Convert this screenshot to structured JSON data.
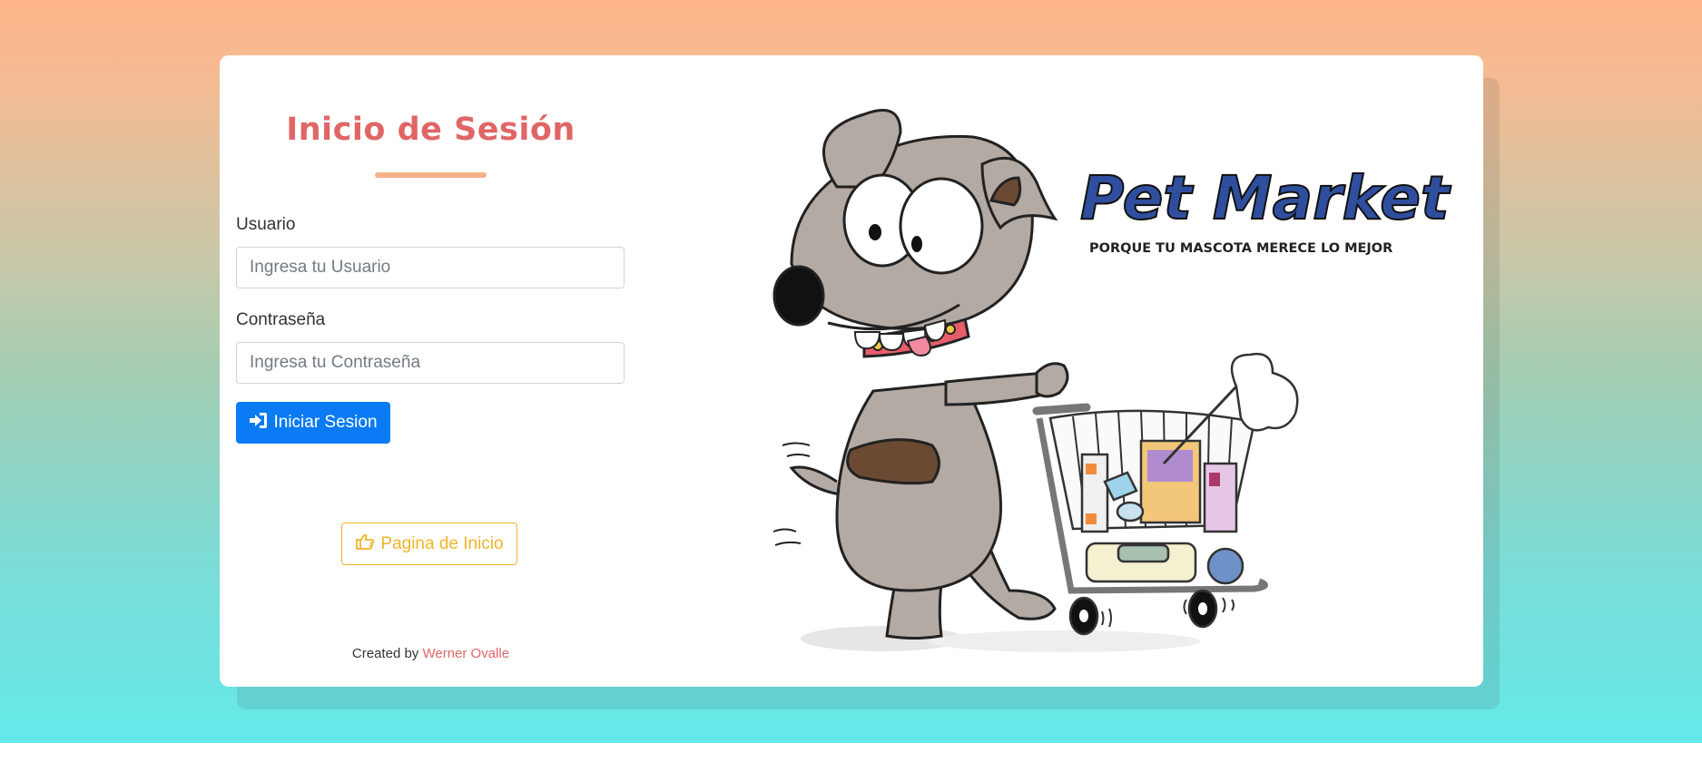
{
  "login": {
    "title": "Inicio de Sesión",
    "username_label": "Usuario",
    "username_placeholder": "Ingresa tu Usuario",
    "username_value": "",
    "password_label": "Contraseña",
    "password_placeholder": "Ingresa tu Contraseña",
    "password_value": "",
    "login_button": "Iniciar Sesion",
    "login_icon": "sign-in-icon",
    "home_button": "Pagina de Inicio",
    "home_icon": "hand-pointing-icon"
  },
  "footer": {
    "created_by": "Created by",
    "author": "Werner Ovalle"
  },
  "brand": {
    "name": "Pet Market",
    "tagline": "PORQUE TU MASCOTA MERECE LO MEJOR"
  },
  "colors": {
    "title": "#e06666",
    "accent_underline": "#f6b28a",
    "primary_button": "#0a7bf5",
    "warning_button": "#f0b429",
    "brand_blue": "#2f4f9e"
  }
}
